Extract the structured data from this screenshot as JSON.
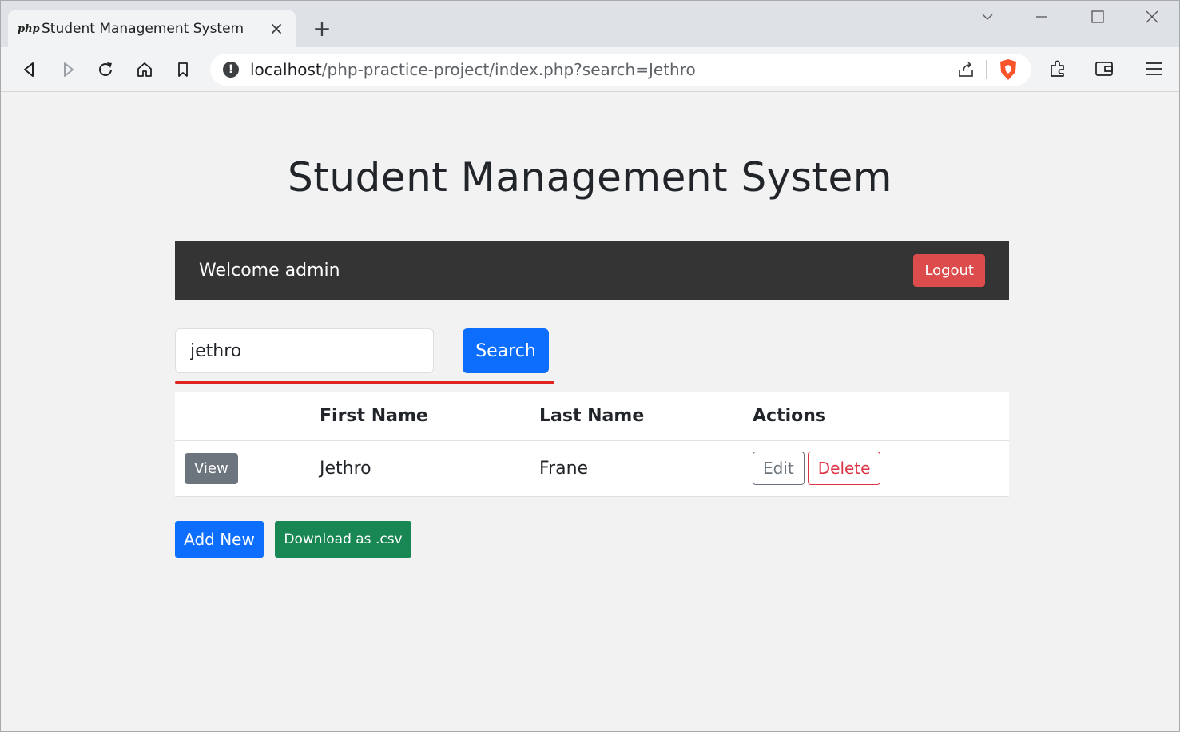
{
  "browser": {
    "tab": {
      "favicon": "php",
      "title": "Student Management System"
    },
    "new_tab_label": "+",
    "url_host": "localhost",
    "url_path": "/php-practice-project/index.php?search=Jethro",
    "info_label": "!"
  },
  "page": {
    "title": "Student Management System",
    "welcome_text": "Welcome admin",
    "logout_label": "Logout",
    "search": {
      "value": "jethro",
      "button_label": "Search"
    },
    "table": {
      "headers": [
        "",
        "First Name",
        "Last Name",
        "Actions"
      ],
      "rows": [
        {
          "view_label": "View",
          "first_name": "Jethro",
          "last_name": "Frane",
          "edit_label": "Edit",
          "delete_label": "Delete"
        }
      ]
    },
    "add_new_label": "Add New",
    "download_label": "Download as .csv"
  },
  "colors": {
    "primary": "#0d6efd",
    "danger": "#dc3545",
    "success": "#198754",
    "secondary": "#6c757d",
    "header_bar": "#343434"
  }
}
